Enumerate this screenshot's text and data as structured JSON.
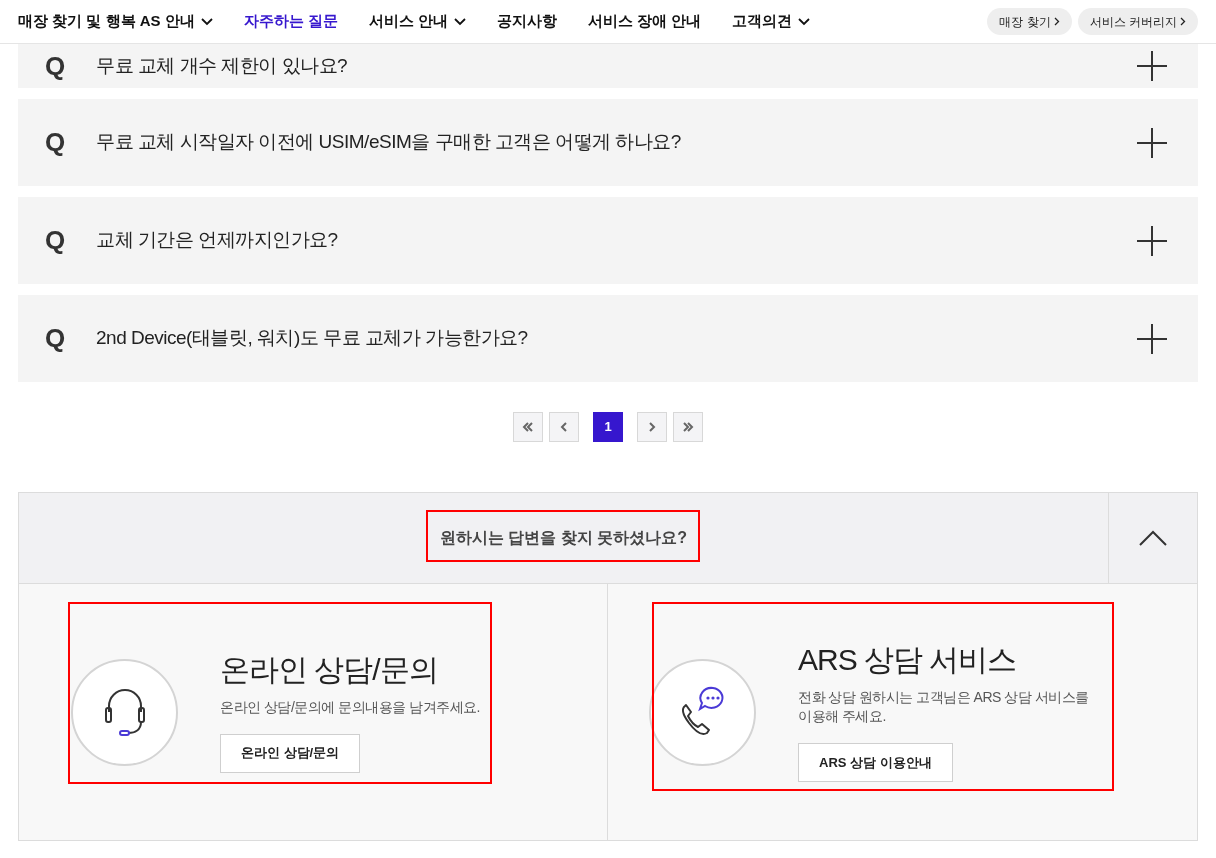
{
  "nav": {
    "items": [
      {
        "label": "매장 찾기 및 행복 AS 안내",
        "dropdown": true,
        "selected": false
      },
      {
        "label": "자주하는 질문",
        "dropdown": false,
        "selected": true
      },
      {
        "label": "서비스 안내",
        "dropdown": true,
        "selected": false
      },
      {
        "label": "공지사항",
        "dropdown": false,
        "selected": false
      },
      {
        "label": "서비스 장애 안내",
        "dropdown": false,
        "selected": false
      },
      {
        "label": "고객의견",
        "dropdown": true,
        "selected": false
      }
    ],
    "buttons": [
      "매장 찾기",
      "서비스 커버리지"
    ]
  },
  "faq": [
    {
      "mark": "Q",
      "question": "무료 교체 개수 제한이 있나요?",
      "expanded": false
    },
    {
      "mark": "Q",
      "question": "무료 교체 시작일자 이전에 USIM/eSIM을 구매한 고객은 어떻게 하나요?",
      "expanded": false
    },
    {
      "mark": "Q",
      "question": "교체 기간은 언제까지인가요?",
      "expanded": false
    },
    {
      "mark": "Q",
      "question": "2nd Device(태블릿, 워치)도 무료 교체가 가능한가요?",
      "expanded": false
    }
  ],
  "pagination": {
    "pages": [
      {
        "label": "1",
        "selected": true
      }
    ]
  },
  "help": {
    "title": "원하시는 답변을 찾지 못하셨나요?",
    "expanded": true,
    "cards": [
      {
        "kind": "headset",
        "title": "온라인 상담/문의",
        "description": "온라인 상담/문의에 문의내용을 남겨주세요.",
        "button": "온라인 상담/문의"
      },
      {
        "kind": "phone",
        "title": "ARS 상담 서비스",
        "description": "전화 상담 원하시는 고객님은 ARS 상담 서비스를 이용해 주세요.",
        "button": "ARS 상담 이용안내"
      }
    ]
  }
}
